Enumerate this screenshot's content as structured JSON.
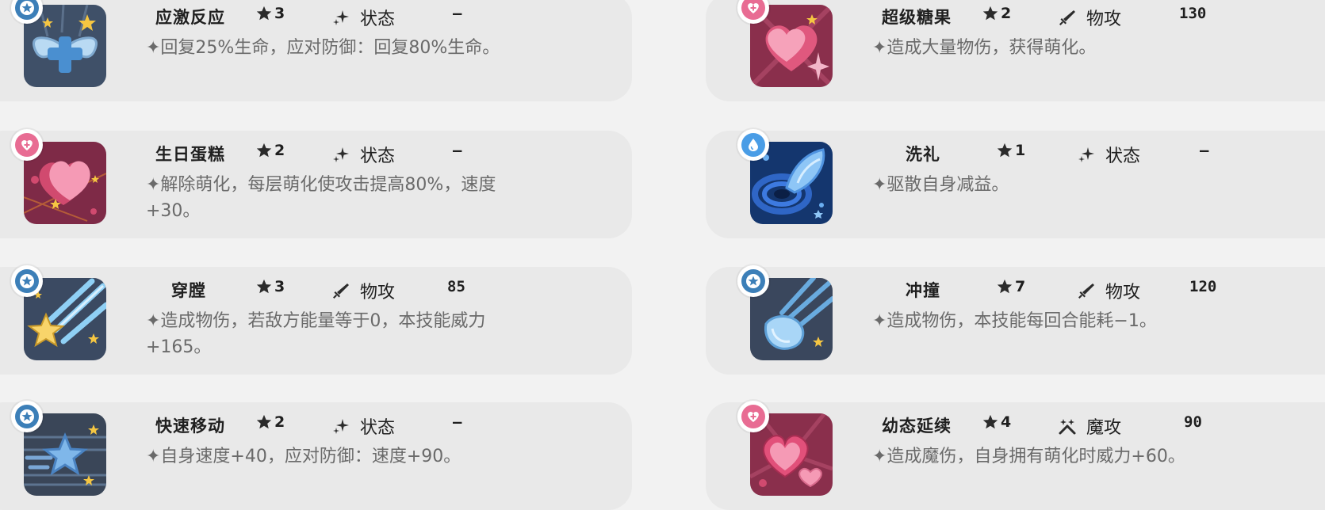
{
  "skills": [
    {
      "name": "应激反应",
      "rank": "3",
      "category": "状态",
      "power": "–",
      "desc": "✦回复25%生命，应对防御：回复80%生命。",
      "badge": "blue",
      "catIcon": "sparkle-icon",
      "art": "bandage"
    },
    {
      "name": "超级糖果",
      "rank": "2",
      "category": "物攻",
      "power": "130",
      "desc": "✦造成大量物伤，获得萌化。",
      "badge": "pink",
      "catIcon": "sword-icon",
      "art": "heart"
    },
    {
      "name": "生日蛋糕",
      "rank": "2",
      "category": "状态",
      "power": "–",
      "desc": "✦解除萌化，每层萌化使攻击提高80%，速度+30。",
      "badge": "pink",
      "catIcon": "sparkle-icon",
      "art": "heart2"
    },
    {
      "name": "洗礼",
      "rank": "1",
      "category": "状态",
      "power": "–",
      "desc": "✦驱散自身减益。",
      "badge": "water",
      "catIcon": "sparkle-icon",
      "art": "water"
    },
    {
      "name": "穿膛",
      "rank": "3",
      "category": "物攻",
      "power": "85",
      "desc": "✦造成物伤，若敌方能量等于0，本技能威力+165。",
      "badge": "blue",
      "catIcon": "sword-icon",
      "art": "star"
    },
    {
      "name": "冲撞",
      "rank": "7",
      "category": "物攻",
      "power": "120",
      "desc": "✦造成物伤，本技能每回合能耗−1。",
      "badge": "blue",
      "catIcon": "sword-icon",
      "art": "comet"
    },
    {
      "name": "快速移动",
      "rank": "2",
      "category": "状态",
      "power": "–",
      "desc": "✦自身速度+40，应对防御：速度+90。",
      "badge": "blue",
      "catIcon": "sparkle-icon",
      "art": "speedstar"
    },
    {
      "name": "幼态延续",
      "rank": "4",
      "category": "魔攻",
      "power": "90",
      "desc": "✦造成魔伤，自身拥有萌化时威力+60。",
      "badge": "pink",
      "catIcon": "magic-icon",
      "art": "hearts"
    }
  ]
}
